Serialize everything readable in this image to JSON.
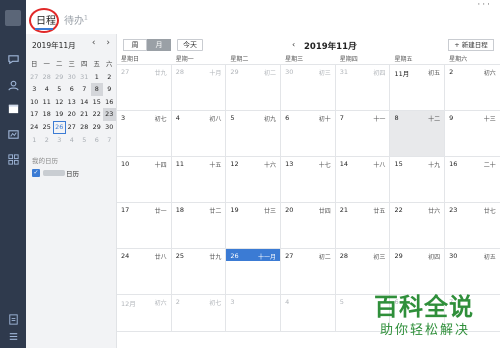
{
  "rail": {
    "icons": [
      "avatar",
      "chat-icon",
      "contacts-icon",
      "calendar-icon",
      "mail-icon",
      "apps-icon",
      "notes-icon",
      "menu-icon"
    ]
  },
  "top": {
    "tab_calendar": "日程",
    "tab_todo": "待办",
    "todo_badge": "1",
    "window_more": "···"
  },
  "mini": {
    "title": "2019年11月",
    "prev": "‹",
    "next": "›",
    "weekdays": [
      "日",
      "一",
      "二",
      "三",
      "四",
      "五",
      "六"
    ],
    "weeks": [
      [
        "27",
        "28",
        "29",
        "30",
        "31",
        "1",
        "2"
      ],
      [
        "3",
        "4",
        "5",
        "6",
        "7",
        "8",
        "9"
      ],
      [
        "10",
        "11",
        "12",
        "13",
        "14",
        "15",
        "16"
      ],
      [
        "17",
        "18",
        "19",
        "20",
        "21",
        "22",
        "23"
      ],
      [
        "24",
        "25",
        "26",
        "27",
        "28",
        "29",
        "30"
      ],
      [
        "1",
        "2",
        "3",
        "4",
        "5",
        "6",
        "7"
      ]
    ],
    "my_calendars_label": "我的日历",
    "calendar_name": "日历"
  },
  "toolbar": {
    "week": "周",
    "month": "月",
    "today": "今天",
    "prev": "‹",
    "title": "2019年11月",
    "next": "›",
    "new_event": "+ 新建日程"
  },
  "grid": {
    "weekdays": [
      "星期日",
      "星期一",
      "星期二",
      "星期三",
      "星期四",
      "星期五",
      "星期六"
    ],
    "weeks": [
      [
        {
          "d": "27",
          "l": "廿九",
          "m": true
        },
        {
          "d": "28",
          "l": "十月",
          "m": true
        },
        {
          "d": "29",
          "l": "初二",
          "m": true
        },
        {
          "d": "30",
          "l": "初三",
          "m": true
        },
        {
          "d": "31",
          "l": "初四",
          "m": true
        },
        {
          "d": "11月",
          "l": "初五"
        },
        {
          "d": "2",
          "l": "初六"
        }
      ],
      [
        {
          "d": "3",
          "l": "初七"
        },
        {
          "d": "4",
          "l": "初八"
        },
        {
          "d": "5",
          "l": "初九"
        },
        {
          "d": "6",
          "l": "初十"
        },
        {
          "d": "7",
          "l": "十一"
        },
        {
          "d": "8",
          "l": "十二",
          "g": true
        },
        {
          "d": "9",
          "l": "十三"
        }
      ],
      [
        {
          "d": "10",
          "l": "十四"
        },
        {
          "d": "11",
          "l": "十五"
        },
        {
          "d": "12",
          "l": "十六"
        },
        {
          "d": "13",
          "l": "十七"
        },
        {
          "d": "14",
          "l": "十八"
        },
        {
          "d": "15",
          "l": "十九"
        },
        {
          "d": "16",
          "l": "二十"
        }
      ],
      [
        {
          "d": "17",
          "l": "廿一"
        },
        {
          "d": "18",
          "l": "廿二"
        },
        {
          "d": "19",
          "l": "廿三"
        },
        {
          "d": "20",
          "l": "廿四"
        },
        {
          "d": "21",
          "l": "廿五"
        },
        {
          "d": "22",
          "l": "廿六"
        },
        {
          "d": "23",
          "l": "廿七"
        }
      ],
      [
        {
          "d": "24",
          "l": "廿八"
        },
        {
          "d": "25",
          "l": "廿九"
        },
        {
          "d": "26",
          "l": "十一月",
          "s": true
        },
        {
          "d": "27",
          "l": "初二"
        },
        {
          "d": "28",
          "l": "初三"
        },
        {
          "d": "29",
          "l": "初四"
        },
        {
          "d": "30",
          "l": "初五"
        }
      ],
      [
        {
          "d": "12月",
          "l": "初六",
          "m": true
        },
        {
          "d": "2",
          "l": "初七",
          "m": true
        },
        {
          "d": "3",
          "l": "",
          "m": true
        },
        {
          "d": "4",
          "l": "",
          "m": true
        },
        {
          "d": "5",
          "l": "",
          "m": true
        },
        {
          "d": "6",
          "l": "",
          "m": true
        },
        {
          "d": "7",
          "l": "",
          "m": true
        }
      ]
    ]
  },
  "watermark": {
    "big": "百科全说",
    "small": "助你轻松解决"
  },
  "colors": {
    "accent": "#3b7bd4",
    "rail": "#2f3a4d",
    "highlight": "#e12828",
    "watermark": "#2f8f3a"
  }
}
